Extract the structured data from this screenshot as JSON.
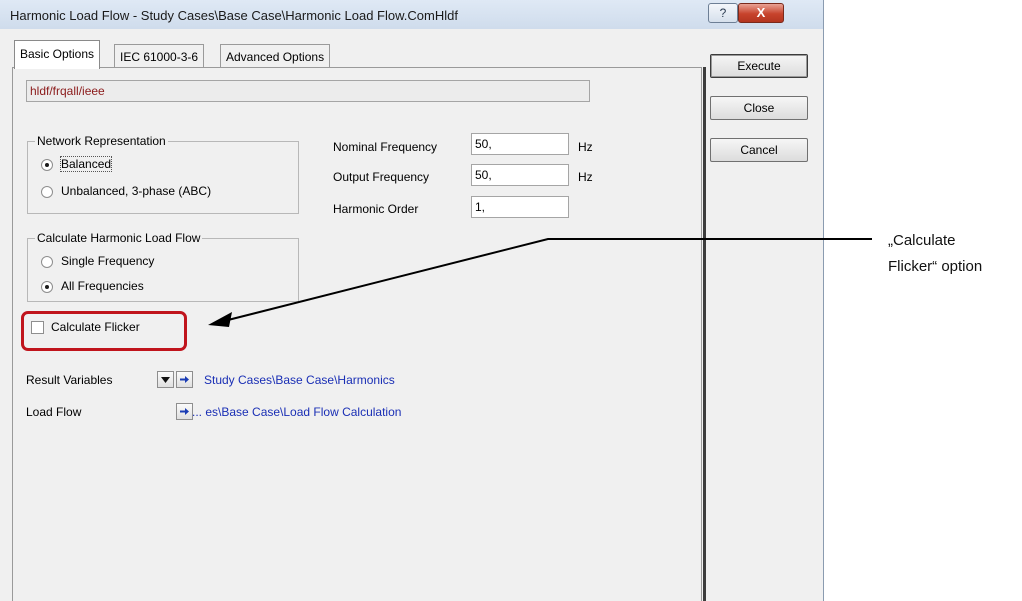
{
  "window": {
    "title": "Harmonic Load Flow - Study Cases\\Base Case\\Harmonic Load Flow.ComHldf",
    "help_glyph": "?",
    "close_glyph": "X"
  },
  "tabs": [
    {
      "label": "Basic Options",
      "active": true
    },
    {
      "label": "IEC 61000-3-6",
      "active": false
    },
    {
      "label": "Advanced Options",
      "active": false
    }
  ],
  "command_field": {
    "value": "hldf/frqall/ieee"
  },
  "network_representation": {
    "legend": "Network Representation",
    "options": [
      {
        "label": "Balanced",
        "selected": true
      },
      {
        "label": "Unbalanced, 3-phase (ABC)",
        "selected": false
      }
    ]
  },
  "frequency": {
    "nominal": {
      "label": "Nominal Frequency",
      "value": "50,",
      "unit": "Hz"
    },
    "output": {
      "label": "Output Frequency",
      "value": "50,",
      "unit": "Hz"
    },
    "harmonic_order": {
      "label": "Harmonic Order",
      "value": "1,"
    }
  },
  "calc_mode": {
    "legend": "Calculate Harmonic Load Flow",
    "options": [
      {
        "label": "Single Frequency",
        "selected": false
      },
      {
        "label": "All Frequencies",
        "selected": true
      }
    ]
  },
  "flicker": {
    "label": "Calculate Flicker",
    "checked": false
  },
  "result_variables": {
    "label": "Result Variables",
    "link": "Study Cases\\Base Case\\Harmonics"
  },
  "load_flow": {
    "label": "Load Flow",
    "link": "... es\\Base Case\\Load Flow Calculation"
  },
  "buttons": {
    "execute": "Execute",
    "close": "Close",
    "cancel": "Cancel"
  },
  "annotation": {
    "line1": "„Calculate",
    "line2": "Flicker“ option"
  },
  "colors": {
    "highlight": "#c0141c",
    "link": "#1a2fb5",
    "command_text": "#8b1a1a"
  },
  "icons": {
    "dropdown": "down-triangle-icon",
    "jump": "right-arrow-icon"
  }
}
